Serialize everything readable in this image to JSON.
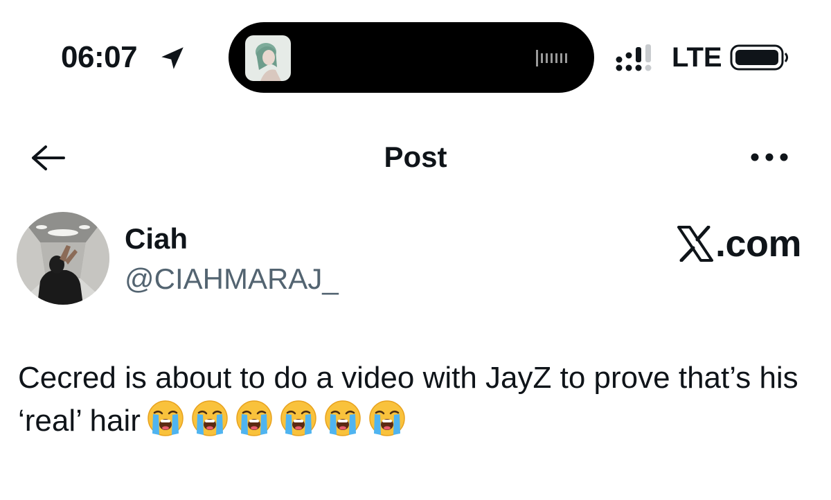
{
  "status_bar": {
    "time": "06:07",
    "network": "LTE",
    "icons": [
      "location-arrow-icon",
      "album-art-thumbnail",
      "audio-waveform-icon",
      "signal-strength-icon",
      "battery-icon"
    ]
  },
  "header": {
    "title": "Post",
    "icons": [
      "back-arrow-icon",
      "more-options-icon"
    ]
  },
  "post": {
    "author": {
      "display_name": "Ciah",
      "handle": "@CIAHMARAJ_"
    },
    "brand": {
      "logo": "x-logo-icon",
      "suffix": ".com"
    },
    "text": "Cecred is about to do a video with JayZ to prove that’s his ‘real’ hair",
    "emojis": [
      "loudly-crying-face",
      "loudly-crying-face",
      "loudly-crying-face",
      "loudly-crying-face",
      "loudly-crying-face",
      "loudly-crying-face"
    ]
  },
  "colors": {
    "text_primary": "#0f1419",
    "text_secondary": "#536471",
    "background": "#ffffff",
    "island": "#000000"
  }
}
